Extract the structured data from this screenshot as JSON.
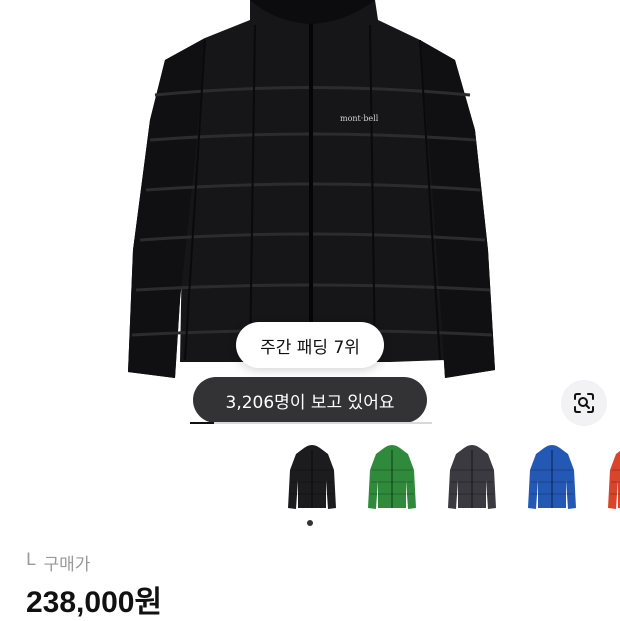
{
  "product": {
    "brand_logo": "mont·bell",
    "image_alt": "black down jacket"
  },
  "badges": {
    "weekly_rank": "주간 패딩 7위",
    "viewers": "3,206명이 보고 있어요"
  },
  "gallery": {
    "progress_fraction": 0.1,
    "thumbnails": [
      {
        "name": "black",
        "color": "#1c1c1e"
      },
      {
        "name": "green",
        "color": "#2f8a3c"
      },
      {
        "name": "dark-gray",
        "color": "#3a3a40"
      },
      {
        "name": "blue",
        "color": "#2458b5"
      },
      {
        "name": "red",
        "color": "#d9452b"
      }
    ]
  },
  "purchase": {
    "size": "L",
    "price_label": "구매가",
    "price": "238,000원"
  },
  "icons": {
    "lens": "lens-search-icon"
  }
}
